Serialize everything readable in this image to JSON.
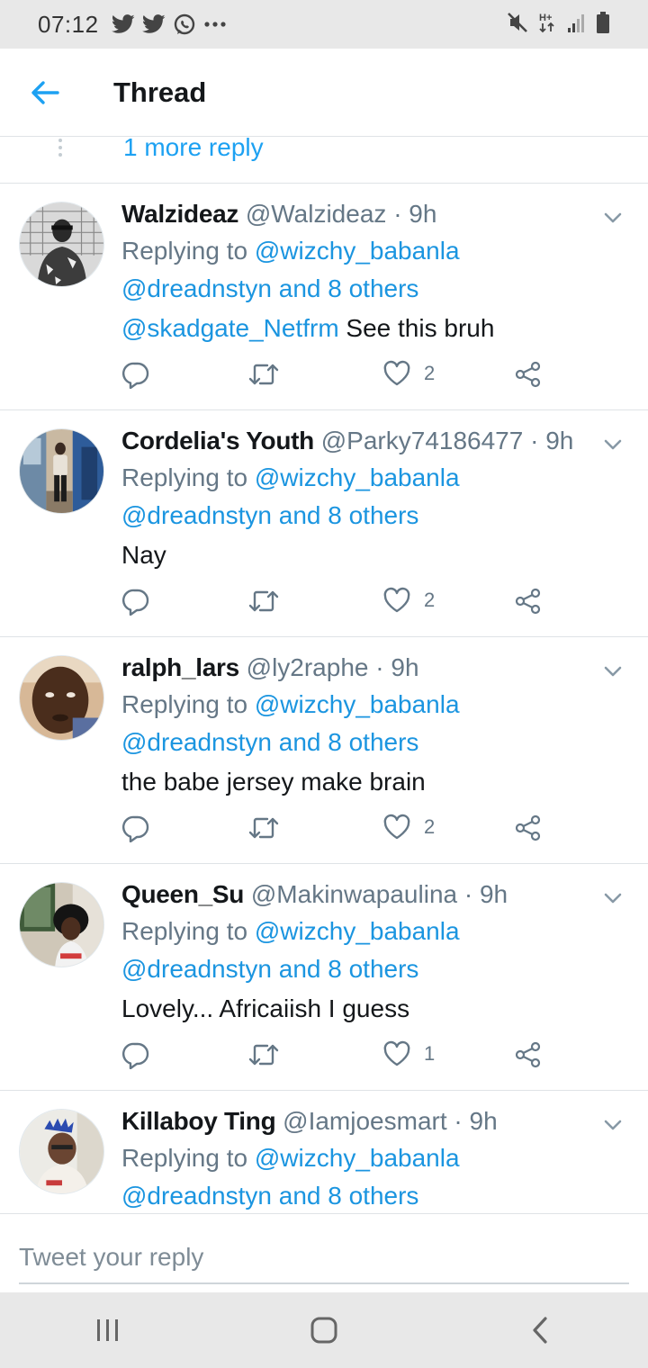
{
  "status_bar": {
    "time": "07:12",
    "left_icons": [
      "twitter-icon",
      "twitter-icon",
      "whatsapp-icon",
      "more-dots-icon"
    ],
    "right_icons": [
      "mute-icon",
      "data-h-plus-icon",
      "signal-icon",
      "battery-icon"
    ]
  },
  "header": {
    "title": "Thread",
    "back_icon": "arrow-left-icon"
  },
  "thread": {
    "more_reply": "1 more reply",
    "tweets": [
      {
        "name": "Walzideaz",
        "handle": "@Walzideaz",
        "separator": "·",
        "time": "9h",
        "replying_to_label": "Replying to",
        "replying_to_user": "@wizchy_babanla",
        "replying_to_rest": "@dreadnstyn and 8 others",
        "text_mention": "@skadgate_Netfrm",
        "text": "See this bruh",
        "likes": "2"
      },
      {
        "name": "Cordelia's Youth",
        "handle": "@Parky74186477",
        "separator": "·",
        "time": "9h",
        "replying_to_label": "Replying to",
        "replying_to_user": "@wizchy_babanla",
        "replying_to_rest": "@dreadnstyn and 8 others",
        "text_mention": "",
        "text": "Nay",
        "likes": "2"
      },
      {
        "name": "ralph_lars",
        "handle": "@ly2raphe",
        "separator": "·",
        "time": "9h",
        "replying_to_label": "Replying to",
        "replying_to_user": "@wizchy_babanla",
        "replying_to_rest": "@dreadnstyn and 8 others",
        "text_mention": "",
        "text": "the babe jersey make brain",
        "likes": "2"
      },
      {
        "name": "Queen_Su",
        "handle": "@Makinwapaulina",
        "separator": "·",
        "time": "9h",
        "replying_to_label": "Replying to",
        "replying_to_user": "@wizchy_babanla",
        "replying_to_rest": "@dreadnstyn and 8 others",
        "text_mention": "",
        "text": "Lovely... Africaiish I guess",
        "likes": "1"
      },
      {
        "name": "Killaboy Ting",
        "handle": "@Iamjoesmart",
        "separator": "·",
        "time": "9h",
        "replying_to_label": "Replying to",
        "replying_to_user": "@wizchy_babanla",
        "replying_to_rest": "@dreadnstyn and 8 others"
      }
    ]
  },
  "reply_bar": {
    "placeholder": "Tweet your reply"
  },
  "nav_bar": {
    "buttons": [
      "recent-apps-icon",
      "home-icon",
      "back-icon"
    ]
  },
  "colors": {
    "accent": "#1da1f2",
    "link": "#1b95e0",
    "text": "#14171a",
    "secondary": "#657786",
    "divider": "#dfe3e6",
    "system_bar": "#e8e8e8"
  }
}
